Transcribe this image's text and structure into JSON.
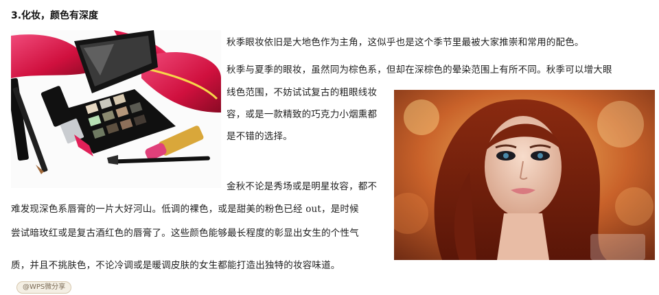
{
  "article": {
    "heading": "3.化妆，颜色有深度",
    "lines": [
      "秋季眼妆依旧是大地色作为主角，这似乎也是这个季节里最被大家推崇和常用的配色。",
      "秋季与夏季的眼妆，虽然同为棕色系，但却在深棕色的晕染范围上有所不同。秋季可以增大眼",
      "线色范围，不妨试试复古的粗眼线妆",
      "容，或是一款精致的巧克力小烟熏都",
      "是不错的选择。",
      "金秋不论是秀场或是明星妆容，都不",
      "难发现深色系唇膏的一片大好河山。低调的裸色，或是甜美的粉色已经 out，是时候",
      "尝试暗玫红或是复古酒红色的唇膏了。这些颜色能够最长程度的彰显出女生的个性气",
      "质，并且不挑肤色，不论冷调或是暖调皮肤的女生都能打造出独特的妆容味道。"
    ]
  },
  "images": {
    "makeup_alt": "",
    "portrait_alt": ""
  },
  "watermark": {
    "source_badge": "@WPS微分享"
  }
}
